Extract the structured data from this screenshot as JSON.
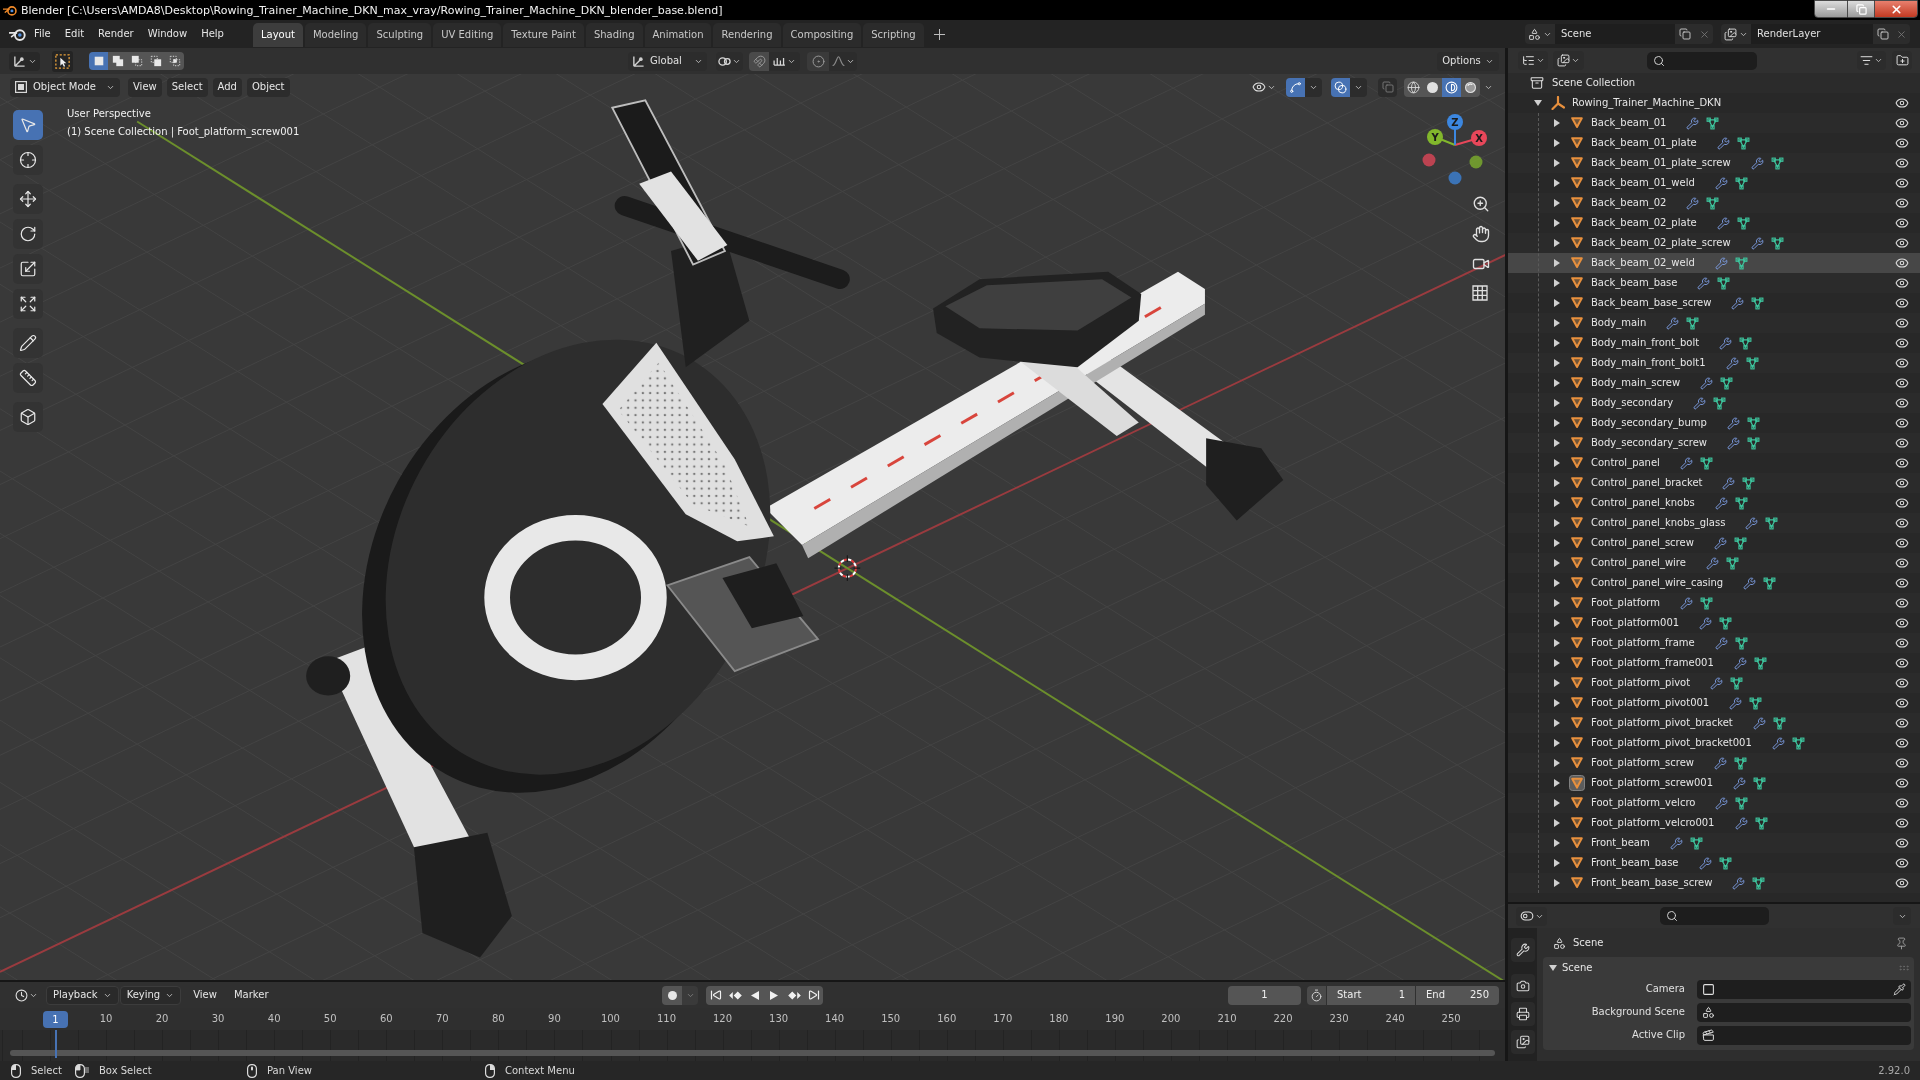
{
  "window": {
    "title": "Blender [C:\\Users\\AMDA8\\Desktop\\Rowing_Trainer_Machine_DKN_max_vray/Rowing_Trainer_Machine_DKN_blender_base.blend]"
  },
  "menu": [
    "File",
    "Edit",
    "Render",
    "Window",
    "Help"
  ],
  "workspaces": [
    {
      "label": "Layout",
      "selected": true
    },
    {
      "label": "Modeling",
      "selected": false
    },
    {
      "label": "Sculpting",
      "selected": false
    },
    {
      "label": "UV Editing",
      "selected": false
    },
    {
      "label": "Texture Paint",
      "selected": false
    },
    {
      "label": "Shading",
      "selected": false
    },
    {
      "label": "Animation",
      "selected": false
    },
    {
      "label": "Rendering",
      "selected": false
    },
    {
      "label": "Compositing",
      "selected": false
    },
    {
      "label": "Scripting",
      "selected": false
    }
  ],
  "scene": "Scene",
  "view_layer": "RenderLayer",
  "viewport": {
    "selection_modes": [
      {
        "kind": "set",
        "selected": true
      },
      {
        "kind": "extend",
        "selected": false
      },
      {
        "kind": "subtract",
        "selected": false
      },
      {
        "kind": "invert",
        "selected": false
      },
      {
        "kind": "intersect",
        "selected": false
      }
    ],
    "orientation": "Global",
    "options": "Options",
    "mode": "Object Mode",
    "menus": [
      "View",
      "Select",
      "Add",
      "Object"
    ],
    "gizmos_on": true,
    "overlays_on": true,
    "xray_on": false,
    "shading": [
      {
        "kind": "wireframe",
        "selected": false
      },
      {
        "kind": "solid",
        "selected": false
      },
      {
        "kind": "material",
        "selected": true
      },
      {
        "kind": "rendered",
        "selected": false
      }
    ],
    "tools": [
      {
        "kind": "select",
        "selected": true
      },
      {
        "kind": "cursor",
        "selected": false
      },
      {
        "kind": "move",
        "selected": false
      },
      {
        "kind": "rotate",
        "selected": false
      },
      {
        "kind": "scale",
        "selected": false
      },
      {
        "kind": "transform",
        "selected": false
      },
      {
        "kind": "annotate",
        "selected": false
      },
      {
        "kind": "measure",
        "selected": false
      },
      {
        "kind": "add_cube",
        "selected": false
      }
    ],
    "info": [
      "User Perspective",
      "(1) Scene Collection | Foot_platform_screw001"
    ],
    "axes": [
      {
        "label": "X",
        "color": "#e8475a"
      },
      {
        "label": "Y",
        "color": "#82b72c"
      },
      {
        "label": "Z",
        "color": "#3c87e0"
      }
    ]
  },
  "timeline": {
    "menus": [
      {
        "label": "Playback",
        "kind": "dropdown"
      },
      {
        "label": "Keying",
        "kind": "dropdown"
      },
      {
        "label": "View",
        "kind": "menu"
      },
      {
        "label": "Marker",
        "kind": "menu"
      }
    ],
    "current_frame": "1",
    "start": {
      "label": "Start",
      "value": "1"
    },
    "end": {
      "label": "End",
      "value": "250"
    },
    "playhead": "1",
    "ruler": [
      "10",
      "20",
      "30",
      "40",
      "50",
      "60",
      "70",
      "80",
      "90",
      "100",
      "110",
      "120",
      "130",
      "140",
      "150",
      "160",
      "170",
      "180",
      "190",
      "200",
      "210",
      "220",
      "230",
      "240",
      "250"
    ]
  },
  "outliner": {
    "root": "Scene Collection",
    "collection": {
      "name": "Rowing_Trainer_Machine_DKN",
      "expanded": true,
      "visible": true,
      "children": [
        {
          "name": "Back_beam_01",
          "expanded": false,
          "visible": true,
          "selected": false,
          "active": false
        },
        {
          "name": "Back_beam_01_plate",
          "expanded": false,
          "visible": true,
          "selected": false,
          "active": false
        },
        {
          "name": "Back_beam_01_plate_screw",
          "expanded": false,
          "visible": true,
          "selected": false,
          "active": false
        },
        {
          "name": "Back_beam_01_weld",
          "expanded": false,
          "visible": true,
          "selected": false,
          "active": false
        },
        {
          "name": "Back_beam_02",
          "expanded": false,
          "visible": true,
          "selected": false,
          "active": false
        },
        {
          "name": "Back_beam_02_plate",
          "expanded": false,
          "visible": true,
          "selected": false,
          "active": false
        },
        {
          "name": "Back_beam_02_plate_screw",
          "expanded": false,
          "visible": true,
          "selected": false,
          "active": false
        },
        {
          "name": "Back_beam_02_weld",
          "expanded": false,
          "visible": true,
          "selected": true,
          "active": false
        },
        {
          "name": "Back_beam_base",
          "expanded": false,
          "visible": true,
          "selected": false,
          "active": false
        },
        {
          "name": "Back_beam_base_screw",
          "expanded": false,
          "visible": true,
          "selected": false,
          "active": false
        },
        {
          "name": "Body_main",
          "expanded": false,
          "visible": true,
          "selected": false,
          "active": false
        },
        {
          "name": "Body_main_front_bolt",
          "expanded": false,
          "visible": true,
          "selected": false,
          "active": false
        },
        {
          "name": "Body_main_front_bolt1",
          "expanded": false,
          "visible": true,
          "selected": false,
          "active": false
        },
        {
          "name": "Body_main_screw",
          "expanded": false,
          "visible": true,
          "selected": false,
          "active": false
        },
        {
          "name": "Body_secondary",
          "expanded": false,
          "visible": true,
          "selected": false,
          "active": false
        },
        {
          "name": "Body_secondary_bump",
          "expanded": false,
          "visible": true,
          "selected": false,
          "active": false
        },
        {
          "name": "Body_secondary_screw",
          "expanded": false,
          "visible": true,
          "selected": false,
          "active": false
        },
        {
          "name": "Control_panel",
          "expanded": false,
          "visible": true,
          "selected": false,
          "active": false
        },
        {
          "name": "Control_panel_bracket",
          "expanded": false,
          "visible": true,
          "selected": false,
          "active": false
        },
        {
          "name": "Control_panel_knobs",
          "expanded": false,
          "visible": true,
          "selected": false,
          "active": false
        },
        {
          "name": "Control_panel_knobs_glass",
          "expanded": false,
          "visible": true,
          "selected": false,
          "active": false
        },
        {
          "name": "Control_panel_screw",
          "expanded": false,
          "visible": true,
          "selected": false,
          "active": false
        },
        {
          "name": "Control_panel_wire",
          "expanded": false,
          "visible": true,
          "selected": false,
          "active": false
        },
        {
          "name": "Control_panel_wire_casing",
          "expanded": false,
          "visible": true,
          "selected": false,
          "active": false
        },
        {
          "name": "Foot_platform",
          "expanded": false,
          "visible": true,
          "selected": false,
          "active": false
        },
        {
          "name": "Foot_platform001",
          "expanded": false,
          "visible": true,
          "selected": false,
          "active": false
        },
        {
          "name": "Foot_platform_frame",
          "expanded": false,
          "visible": true,
          "selected": false,
          "active": false
        },
        {
          "name": "Foot_platform_frame001",
          "expanded": false,
          "visible": true,
          "selected": false,
          "active": false
        },
        {
          "name": "Foot_platform_pivot",
          "expanded": false,
          "visible": true,
          "selected": false,
          "active": false
        },
        {
          "name": "Foot_platform_pivot001",
          "expanded": false,
          "visible": true,
          "selected": false,
          "active": false
        },
        {
          "name": "Foot_platform_pivot_bracket",
          "expanded": false,
          "visible": true,
          "selected": false,
          "active": false
        },
        {
          "name": "Foot_platform_pivot_bracket001",
          "expanded": false,
          "visible": true,
          "selected": false,
          "active": false
        },
        {
          "name": "Foot_platform_screw",
          "expanded": false,
          "visible": true,
          "selected": false,
          "active": false
        },
        {
          "name": "Foot_platform_screw001",
          "expanded": false,
          "visible": true,
          "selected": false,
          "active": true
        },
        {
          "name": "Foot_platform_velcro",
          "expanded": false,
          "visible": true,
          "selected": false,
          "active": false
        },
        {
          "name": "Foot_platform_velcro001",
          "expanded": false,
          "visible": true,
          "selected": false,
          "active": false
        },
        {
          "name": "Front_beam",
          "expanded": false,
          "visible": true,
          "selected": false,
          "active": false
        },
        {
          "name": "Front_beam_base",
          "expanded": false,
          "visible": true,
          "selected": false,
          "active": false
        },
        {
          "name": "Front_beam_base_screw",
          "expanded": false,
          "visible": true,
          "selected": false,
          "active": false
        }
      ]
    }
  },
  "properties": {
    "context": "Scene",
    "panel": {
      "title": "Scene",
      "expanded": true,
      "fields": [
        {
          "label": "Camera",
          "kind": "object"
        },
        {
          "label": "Background Scene",
          "kind": "scene"
        },
        {
          "label": "Active Clip",
          "kind": "clip"
        }
      ]
    }
  },
  "status_bar": {
    "hints": [
      {
        "kind": "left_click",
        "label": "Select"
      },
      {
        "kind": "left_drag",
        "label": "Box Select"
      },
      {
        "kind": "middle_drag",
        "label": "Pan View"
      },
      {
        "kind": "right_click",
        "label": "Context Menu"
      }
    ],
    "version": "2.92.0"
  }
}
